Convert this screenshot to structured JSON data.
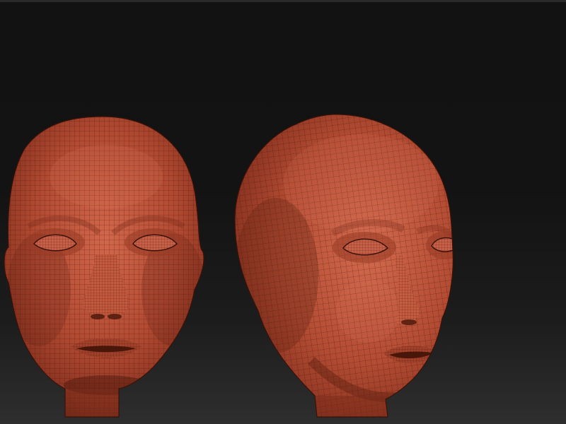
{
  "scene": {
    "background": "#121212",
    "material_color": "#b24a32",
    "wire_color": "#3a1208",
    "models": [
      {
        "name": "head-front",
        "view": "front"
      },
      {
        "name": "head-three-quarter",
        "view": "three-quarter"
      }
    ]
  }
}
